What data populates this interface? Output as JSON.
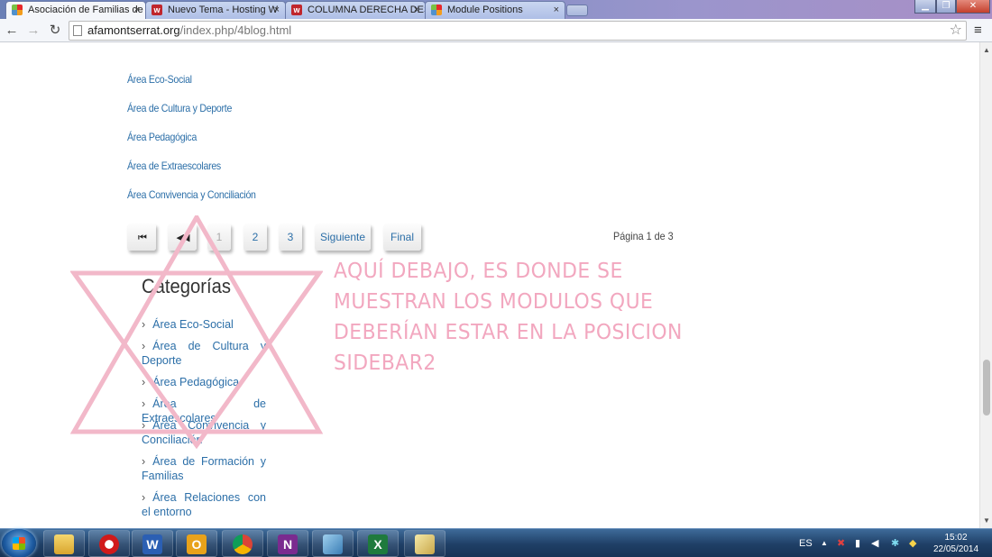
{
  "browser": {
    "tabs": [
      {
        "title": "Asociación de Familias de",
        "icon": "joomla-icon",
        "active": true
      },
      {
        "title": "Nuevo Tema - Hosting W",
        "icon": "webhosting-icon",
        "active": false
      },
      {
        "title": "COLUMNA DERECHA DES",
        "icon": "webhosting-icon",
        "active": false
      },
      {
        "title": "Module Positions",
        "icon": "joomla-icon",
        "active": false
      }
    ],
    "close_glyph": "×",
    "url_host": "afamontserrat.org",
    "url_path": "/index.php/4blog.html"
  },
  "content": {
    "area_links": [
      "Área Eco-Social",
      "Área de Cultura y Deporte",
      "Área Pedagógica",
      "Área de Extraescolares",
      "Área Convivencia y Conciliación"
    ],
    "pagination": {
      "first": "⏮",
      "prev": "◀◀",
      "pages": [
        "1",
        "2",
        "3"
      ],
      "next": "Siguiente",
      "last": "Final",
      "info": "Página 1 de 3"
    },
    "categories": {
      "title": "Categorías",
      "items": [
        "Área Eco-Social",
        "Área de Cultura y Deporte",
        "Área Pedagógica",
        "Área de Extraescolares",
        "Área Convivencia y Conciliación",
        "Área de Formación y Familias",
        "Área Relaciones con el entorno"
      ]
    },
    "annotation": "AQUÍ DEBAJO, ES DONDE SE MUESTRAN LOS MODULOS QUE DEBERÍAN ESTAR EN LA POSICION SIDEBAR2",
    "annotation_color": "#f2a7bf"
  },
  "taskbar": {
    "apps": [
      "explorer",
      "opera",
      "word",
      "outlook",
      "chrome",
      "onenote",
      "unknown-app",
      "excel",
      "paint"
    ],
    "language": "ES",
    "time": "15:02",
    "date": "22/05/2014"
  },
  "colors": {
    "link": "#2c6fa8",
    "taskbar": "#1f3f66"
  }
}
